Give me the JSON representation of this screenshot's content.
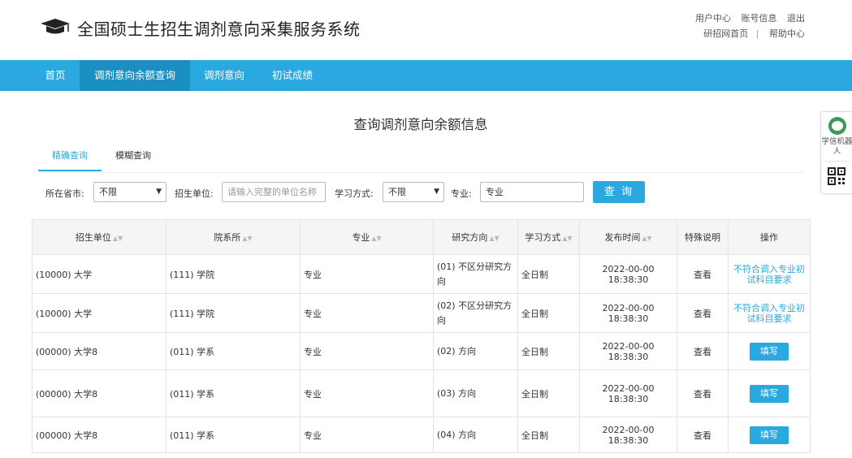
{
  "header": {
    "title": "全国硕士生招生调剂意向采集服务系统",
    "logo_icon": "graduation-cap-icon",
    "links_row1": [
      "用户中心",
      "账号信息",
      "退出"
    ],
    "links_row2": [
      "研招网首页",
      "帮助中心"
    ],
    "links_separator": "|"
  },
  "nav": {
    "items": [
      "首页",
      "调剂意向余额查询",
      "调剂意向",
      "初试成绩"
    ],
    "active_index": 1
  },
  "page": {
    "heading": "查询调剂意向余额信息"
  },
  "tabs": {
    "items": [
      "精确查询",
      "模糊查询"
    ],
    "active_index": 0
  },
  "filters": {
    "province_label": "所在省市:",
    "province_value": "不限",
    "unit_label": "招生单位:",
    "unit_placeholder": "请输入完整的单位名称",
    "mode_label": "学习方式:",
    "mode_value": "不限",
    "major_label": "专业:",
    "major_value": "专业",
    "query_button": "查 询"
  },
  "table": {
    "columns": [
      "招生单位",
      "院系所",
      "专业",
      "研究方向",
      "学习方式",
      "发布时间",
      "特殊说明",
      "操作"
    ],
    "rows": [
      {
        "unit": "(10000) 大学",
        "dept": "(111) 学院",
        "major": "专业",
        "direction": "(01) 不区分研究方向",
        "mode": "全日制",
        "time": "2022-00-00 18:38:30",
        "note": "查看",
        "action": "不符合调入专业初试科目要求",
        "action_type": "text"
      },
      {
        "unit": "(10000) 大学",
        "dept": "(111) 学院",
        "major": "专业",
        "direction": "(02) 不区分研究方向",
        "mode": "全日制",
        "time": "2022-00-00 18:38:30",
        "note": "查看",
        "action": "不符合调入专业初试科目要求",
        "action_type": "text"
      },
      {
        "unit": "(00000) 大学8",
        "dept": "(011) 学系",
        "major": "专业",
        "direction": "(02) 方向",
        "mode": "全日制",
        "time": "2022-00-00 18:38:30",
        "note": "查看",
        "action": "填写",
        "action_type": "button"
      },
      {
        "unit": "(00000) 大学8",
        "dept": "(011) 学系",
        "major": "专业",
        "direction": "(03) 方向",
        "mode": "全日制",
        "time": "2022-00-00 18:38:30",
        "note": "查看",
        "action": "填写",
        "action_type": "button"
      },
      {
        "unit": "(00000) 大学8",
        "dept": "(011) 学系",
        "major": "专业",
        "direction": "(04) 方向",
        "mode": "全日制",
        "time": "2022-00-00 18:38:30",
        "note": "查看",
        "action": "填写",
        "action_type": "button"
      }
    ]
  },
  "side_widget": {
    "robot_label": "学信机器人",
    "robot_icon": "robot-icon",
    "qr_icon": "qr-code-icon"
  },
  "colors": {
    "accent": "#29a9df",
    "nav_active": "#1b8fc2",
    "header_bg": "#f5f5f5"
  }
}
